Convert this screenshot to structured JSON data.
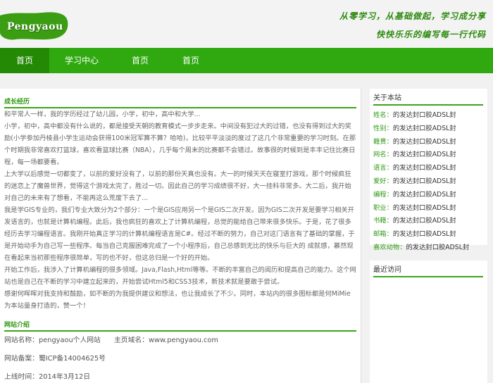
{
  "header": {
    "logo_text": "Pengyaou",
    "slogan_line1": "从零学习，从基础做起，学习成分享",
    "slogan_line2": "快快乐乐的编写每一行代码"
  },
  "nav": {
    "items": [
      {
        "label": "首页"
      },
      {
        "label": "学习中心"
      },
      {
        "label": "首页"
      },
      {
        "label": "首页"
      }
    ]
  },
  "main": {
    "growth_title": "成长经历",
    "paragraphs": [
      "和平常人一样，我的学历经过了幼儿园，小学，初中，高中和大学...",
      "小学，初中，高中都没有什么说的，都是接受天朝的教育模式一步步走来。中间没有犯过大的过错，也没有得到过大的奖励(小学参加丹棱县小学生运动会获得100米冠军算不算？哈哈)，比较平平淡淡的度过了这几个非常重要的学习时刻。在那个时期我非常喜欢打篮球，喜欢看篮球比赛（NBA），几乎每个周末的比赛都不会错过。故事很的时候到是丰丰记住比赛日程，每一场都要看。",
      "上大学以后感觉一切都变了，以前的爱好没有了，以前的那份天真也没有。大一的时候天天在寝室打游戏，那个时候疯狂的迷恋上了魔兽世界，觉得这个游戏太完了，胜过一切。因此自己的学习成绩很不好，大一挂科非常多。大二后，我开始对自己的未来有了想看，不能再这么荒废下去了...",
      "我是学GIS专业的，我们专业大致分为2个部分：一个是GIS应用另一个是GIS二次开发。因为GIS二次开发是要学习相关开发语言的，也就是计算机编程。此后，我也疯狂的喜欢上了计算机编程，总觉的能给自己带来很多快乐。于是，花了很多经历去学习编程语言。我刚开始真正学习的计算机编程语言是C#。经过不断的努力，自己对这门语言有了基础的掌握，于是开始动手为自己写一些程序。每当自己克服困难完成了一个小程序后，自己总感到无比的快乐与巨大的 成就感，慕然现在看起来当初那些程序很简单，写的也不好，但这总归是一个好的开始。",
      "开始工作后，我涉入了计算机编程的很多领域。Java,Flash,Html等等。不断的丰富自己的阅历和提高自己的能力。这个网站也是自己在不断的学习中建立起来的，开始尝试Html5和CSS3技术，新技术就是要敢于尝试。",
      "感谢何晖晖对我支持和鼓励，如不断的为我提供建议和想法，也让我成长了不少。同时，本站内的很多图标都是何MiMie为本站量身打造的，赞一个！"
    ],
    "site_title": "网站介绍",
    "site_name_label": "网站名称：pengyaou个人网站",
    "site_domain_label": "主页域名：www.pengyaou.com",
    "site_icp_label": "网站备案：蜀ICP备14004625号",
    "site_time_label": "上线时间：2014年3月12日"
  },
  "sidebar": {
    "about_title": "关于本站",
    "about_items": [
      {
        "key": "姓名：",
        "value": "的发达封口胶ADSL封"
      },
      {
        "key": "性别：",
        "value": "的发达封口胶ADSL封"
      },
      {
        "key": "籍贯：",
        "value": "的发达封口胶ADSL封"
      },
      {
        "key": "网名：",
        "value": "的发达封口胶ADSL封"
      },
      {
        "key": "语言：",
        "value": "的发达封口胶ADSL封"
      },
      {
        "key": "爱好：",
        "value": "的发达封口胶ADSL封"
      },
      {
        "key": "编程：",
        "value": "的发达封口胶ADSL封"
      },
      {
        "key": "职业：",
        "value": "的发达封口胶ADSL封"
      },
      {
        "key": "书籍：",
        "value": "的发达封口胶ADSL封"
      },
      {
        "key": "邮箱：",
        "value": "的发达封口胶ADSL封"
      },
      {
        "key": "喜欢动物：",
        "value": "的发达封口胶ADSL封"
      }
    ],
    "recent_title": "最近访问"
  },
  "colors": {
    "nav_green": "#2fa90f",
    "nav_active": "#248a06",
    "accent_green": "#2f9a13",
    "logo_green": "#3a9d12"
  }
}
